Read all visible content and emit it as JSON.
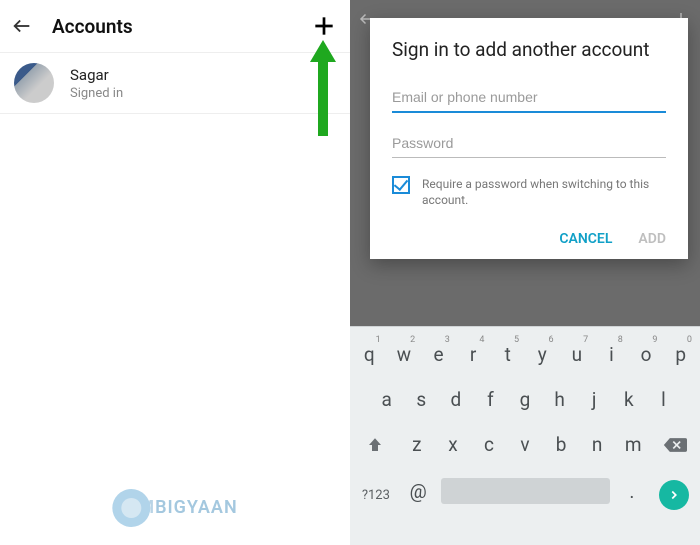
{
  "left": {
    "title": "Accounts",
    "account": {
      "name": "Sagar",
      "status": "Signed in"
    }
  },
  "right": {
    "dialog": {
      "title": "Sign in to add another account",
      "email_placeholder": "Email or phone number",
      "password_placeholder": "Password",
      "checkbox_label": "Require a password when switching to this account.",
      "cancel": "CANCEL",
      "add": "ADD"
    }
  },
  "keyboard": {
    "row1": [
      [
        "q",
        "1"
      ],
      [
        "w",
        "2"
      ],
      [
        "e",
        "3"
      ],
      [
        "r",
        "4"
      ],
      [
        "t",
        "5"
      ],
      [
        "y",
        "6"
      ],
      [
        "u",
        "7"
      ],
      [
        "i",
        "8"
      ],
      [
        "o",
        "9"
      ],
      [
        "p",
        "0"
      ]
    ],
    "row2": [
      "a",
      "s",
      "d",
      "f",
      "g",
      "h",
      "j",
      "k",
      "l"
    ],
    "row3": [
      "z",
      "x",
      "c",
      "v",
      "b",
      "n",
      "m"
    ],
    "sym": "?123",
    "at": "@",
    "dot": "."
  },
  "watermark": "BIGYAAN"
}
